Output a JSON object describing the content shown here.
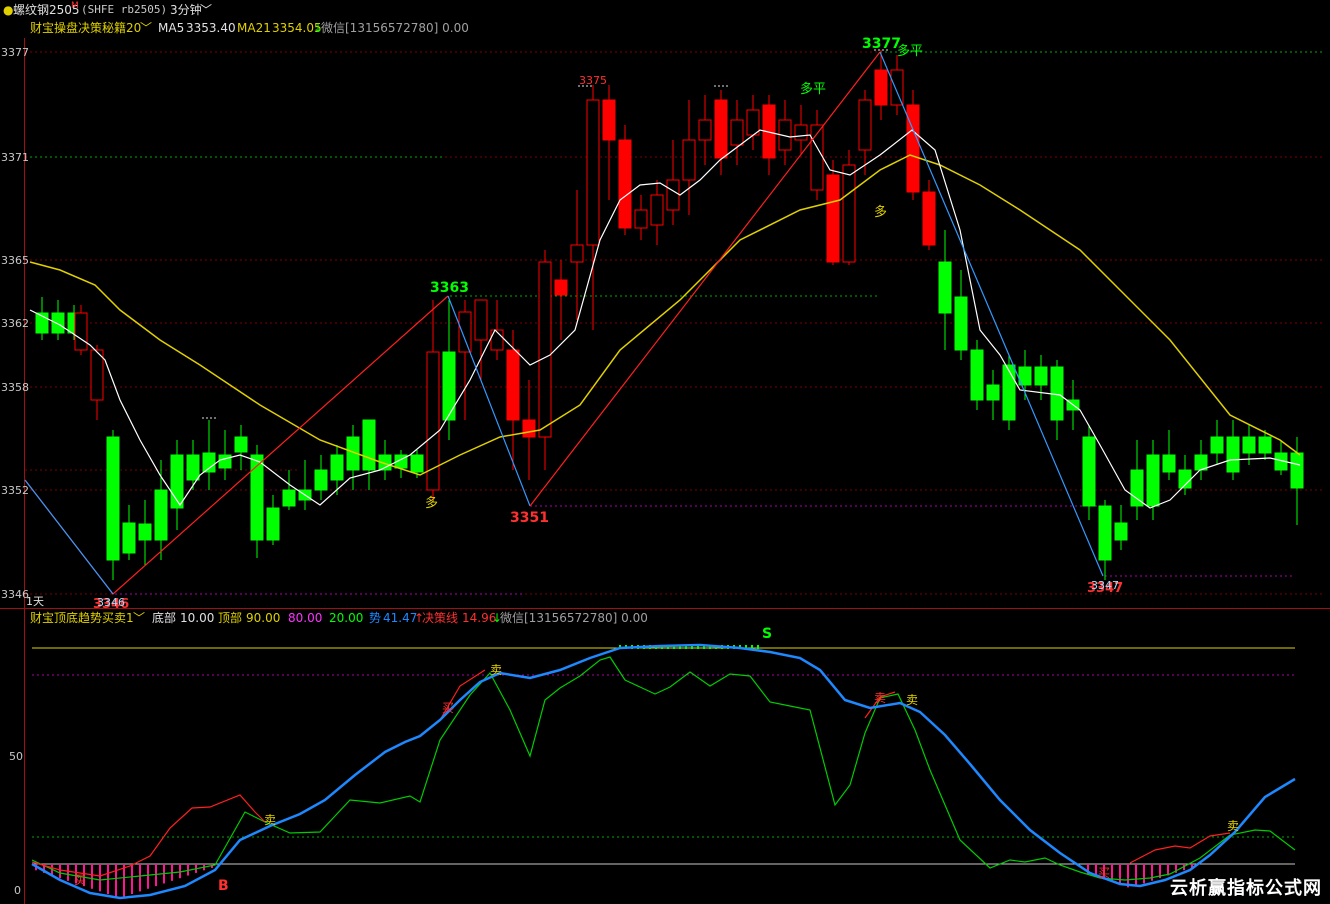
{
  "title_bar": {
    "instrument": "螺纹钢2505",
    "superscript": "M",
    "code": "(SHFE rb2505)",
    "period": "3分钟",
    "period_chevron": "﹀"
  },
  "main_indicator": {
    "name": "财宝操盘决策秘籍20",
    "chevron": "﹀",
    "ma5_label": "MA5",
    "ma5_value": "3353.40",
    "ma21_label": "MA21",
    "ma21_value": "3354.05",
    "ma21_arrow": "↓",
    "wechat": "微信[13156572780] 0.00"
  },
  "price_axis": {
    "ticks": [
      "3377",
      "3371",
      "3365",
      "3362",
      "3358",
      "3352",
      "3346"
    ]
  },
  "time_label": "1天",
  "annotations": {
    "high_3377": "3377",
    "high_3375": "3375",
    "peak_3363": "3363",
    "low_3351": "3351",
    "low_3346_cyan": "3346",
    "low_3346_red": "3346",
    "low_3347_cyan": "3347",
    "low_3347_red": "3347",
    "duo_1": "多",
    "duo_2": "多",
    "duo_ping_1": "多平",
    "duo_ping_2": "多平"
  },
  "sub_indicator": {
    "name": "财宝顶底趋势买卖1",
    "chevron": "﹀",
    "bottom_label": "底部",
    "bottom_value": "10.00",
    "top_label": "顶部",
    "top_value": "90.00",
    "value_80": "80.00",
    "value_20": "20.00",
    "trend_label": "势",
    "trend_value": "41.47",
    "trend_arrow": "↑",
    "decision_label": "决策线",
    "decision_value": "14.96",
    "decision_arrow": "↓",
    "wechat": "微信[13156572780] 0.00",
    "axis_50": "50",
    "axis_0": "0",
    "signal_s": "S",
    "signal_b": "B",
    "sell_1": "卖",
    "sell_2": "卖",
    "sell_3": "卖",
    "sell_4": "卖",
    "sell_5": "卖",
    "buy_1": "买",
    "buy_2": "买",
    "buy_3": "买"
  },
  "watermark": "云析赢指标公式网",
  "colors": {
    "up": "#ff0000",
    "down": "#00ff00",
    "ma5": "#ffffff",
    "ma21": "#e0d000",
    "zigzag_up": "#ff2020",
    "zigzag_down": "#3399ff",
    "trend_blue": "#1e88ff",
    "magenta": "#ff1493"
  }
}
